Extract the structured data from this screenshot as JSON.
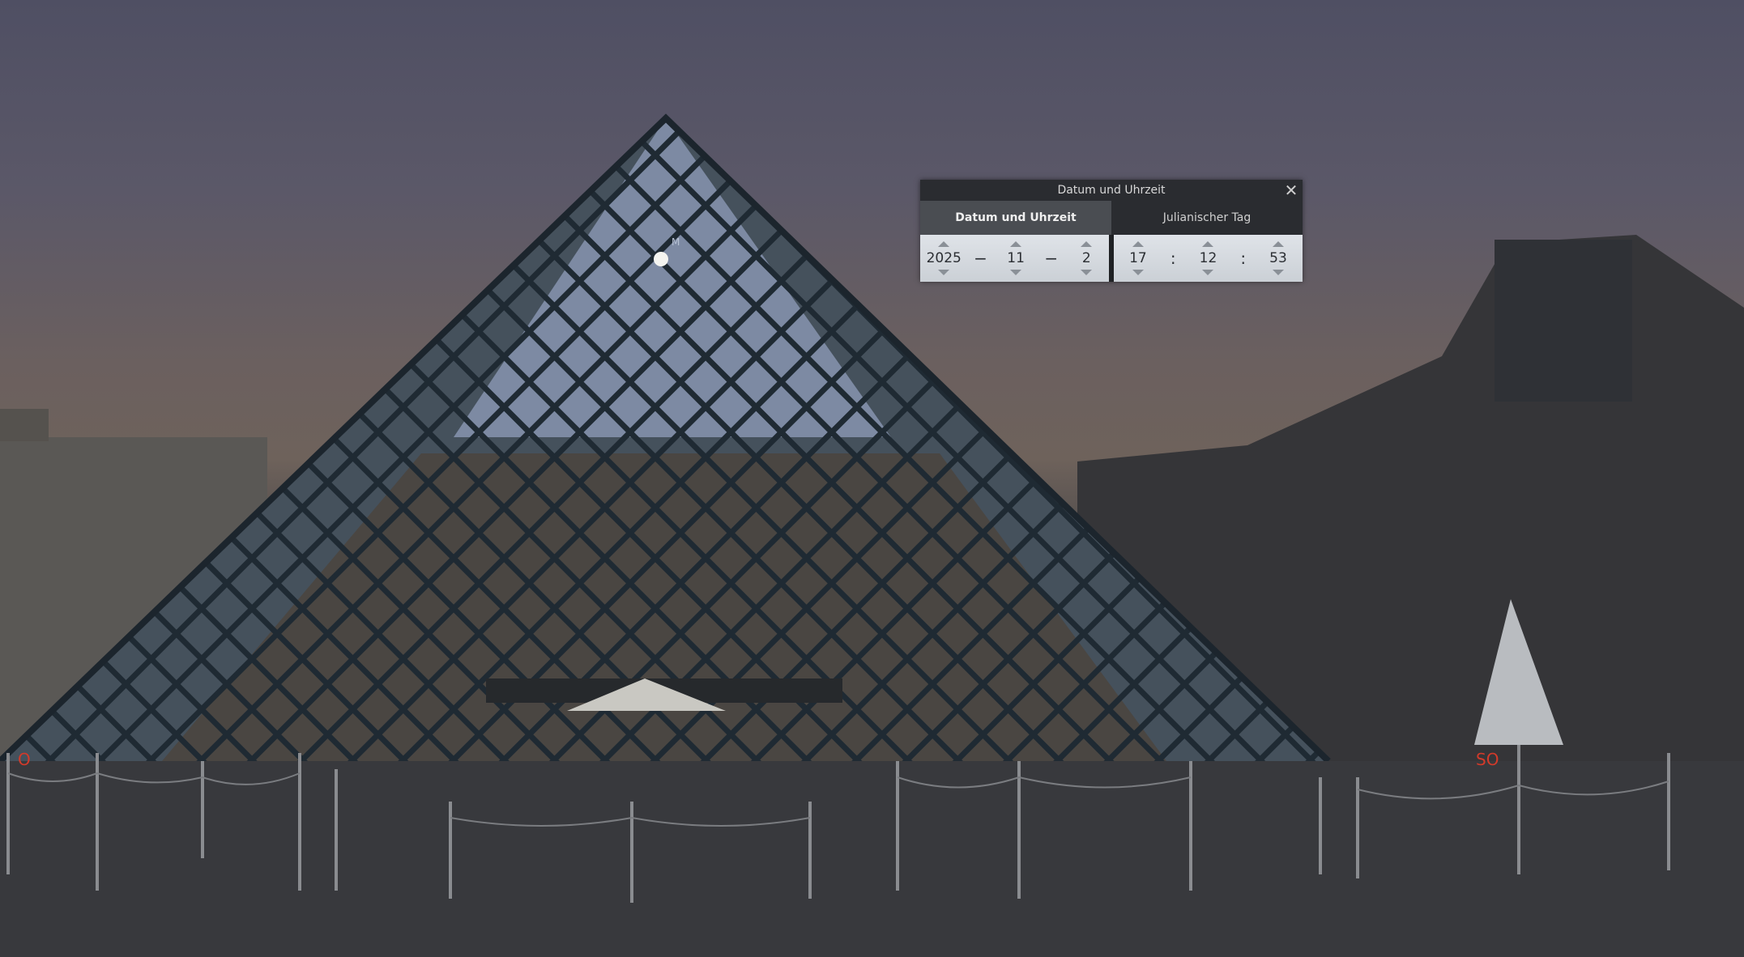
{
  "scene": {
    "compass": {
      "west": "O",
      "southwest": "SO"
    },
    "moon_label": "M"
  },
  "dialog": {
    "title": "Datum und Uhrzeit",
    "close_glyph": "✕",
    "tabs": [
      {
        "label": "Datum und Uhrzeit",
        "active": true
      },
      {
        "label": "Julianischer Tag",
        "active": false
      }
    ],
    "date": {
      "year": "2025",
      "month": "11",
      "day": "2",
      "separator": "−"
    },
    "time": {
      "hour": "17",
      "minute": "12",
      "second": "53",
      "separator": ":"
    }
  }
}
